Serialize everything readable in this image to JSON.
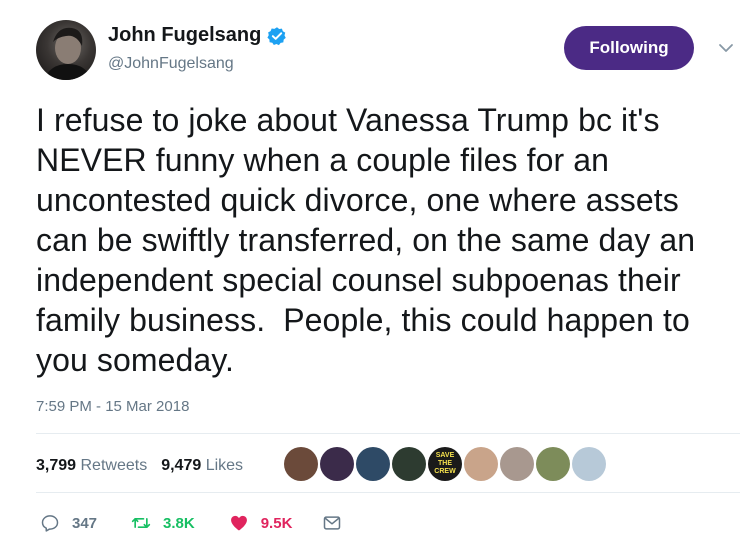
{
  "user": {
    "display_name": "John Fugelsang",
    "handle": "@JohnFugelsang",
    "verified": true,
    "verified_color": "#1da1f2"
  },
  "follow_button": {
    "label": "Following",
    "color": "#4b2a85"
  },
  "tweet": {
    "text": "I refuse to joke about Vanessa Trump bc it's\nNEVER funny when a couple files for an\nuncontested quick divorce, one where assets\ncan be swiftly transferred, on the same day an\nindependent special counsel subpoenas their\nfamily business.  People, this could happen to\nyou someday.",
    "timestamp": "7:59 PM - 15 Mar 2018"
  },
  "stats": {
    "retweets_count": "3,799",
    "retweets_label": "Retweets",
    "likes_count": "9,479",
    "likes_label": "Likes"
  },
  "liker_avatars": [
    {
      "color": "#6b4a3a",
      "text": ""
    },
    {
      "color": "#3b2b4a",
      "text": ""
    },
    {
      "color": "#2e4a66",
      "text": ""
    },
    {
      "color": "#2d3b30",
      "text": ""
    },
    {
      "color": "#1a1a1a",
      "text": "SAVE THE CREW"
    },
    {
      "color": "#c9a48a",
      "text": ""
    },
    {
      "color": "#a8988f",
      "text": ""
    },
    {
      "color": "#7d8c5a",
      "text": ""
    },
    {
      "color": "#b7c9d8",
      "text": ""
    }
  ],
  "actions": {
    "reply_count": "347",
    "retweet_count": "3.8K",
    "like_count": "9.5K"
  },
  "icons": {
    "reply": "reply-icon",
    "retweet": "retweet-icon",
    "like": "heart-icon",
    "dm": "envelope-icon",
    "caret": "chevron-down-icon",
    "verified": "verified-badge-icon"
  },
  "colors": {
    "text": "#14171a",
    "secondary": "#657786",
    "retweet": "#17bf63",
    "like": "#e0245e",
    "divider": "#e6ecf0"
  }
}
